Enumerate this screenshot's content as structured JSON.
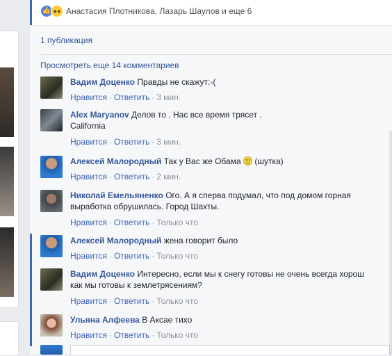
{
  "reactions": {
    "icons": [
      "like-icon",
      "wow-icon"
    ],
    "text": "Анастасия Плотникова, Лазарь Шаулов и еще 6"
  },
  "shares": "1 публикация",
  "view_more": "Просмотреть еще 14 комментариев",
  "actions": {
    "like": "Нравится",
    "reply": "Ответить",
    "sep": "·"
  },
  "comments": [
    {
      "author": "Вадим Доценко",
      "text": "Правды не скажут:-(",
      "time": "3 мин."
    },
    {
      "author": "Alex Maryanov",
      "text": "Делов то . Нас все время трясет .",
      "text2": "California",
      "time": "3 мин."
    },
    {
      "author": "Алексей Малородный",
      "text": "Так у Вас же Обама",
      "emoji": "smiley-icon",
      "text_after": " (шутка)",
      "time": "2 мин."
    },
    {
      "author": "Николай Емельяненко",
      "text": "Ого. А я сперва подумал, что под домом горная",
      "text2": "выработка обрушилась. Город Шахты.",
      "time": "Только что"
    },
    {
      "author": "Алексей Малородный",
      "text": "жена говорит было",
      "time": "Только что"
    },
    {
      "author": "Вадим Доценко",
      "text": "Интересно, если мы к снегу готовы не очень всегда хорош",
      "text2": "как мы готовы к землетрясениям?",
      "time": "Только что"
    },
    {
      "author": "Ульяна Алфеева",
      "text": "В Аксае тихо",
      "time": "Только что"
    }
  ],
  "colors": {
    "link": "#365899",
    "accent": "#4267b2",
    "meta": "#90949c"
  }
}
